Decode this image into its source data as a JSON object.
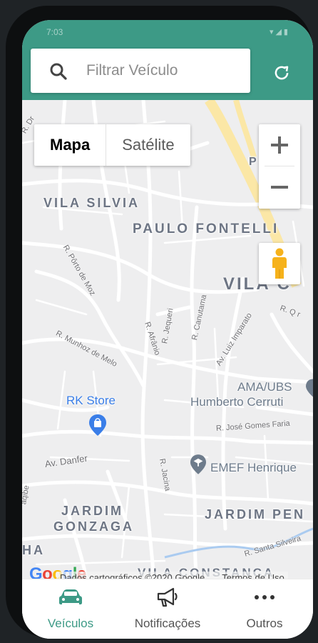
{
  "status_bar": {
    "time": "7:03",
    "icons": "▾◢▮"
  },
  "search": {
    "placeholder": "Filtrar Veículo",
    "value": ""
  },
  "map": {
    "type_buttons": [
      "Mapa",
      "Satélite"
    ],
    "active_type": "Mapa",
    "zoom_in": "+",
    "zoom_out": "−",
    "neighborhoods": {
      "vila_silvia": "VILA SILVIA",
      "paulo_fontelli": "PAULO FONTELLI",
      "vila_c": "VILA C",
      "jardim_gonzaga_1": "JARDIM",
      "jardim_gonzaga_2": "GONZAGA",
      "jardim_pen": "JARDIM PEN",
      "vila_constanca": "VILA CONSTANCA",
      "ha": "HA",
      "pe": "P  E"
    },
    "streets": {
      "porto_de_moz": "R. Pôrto de Moz",
      "munhoz_de_melo": "R. Munhoz de Melo",
      "afranio": "R. Afrânio",
      "jequeri": "R. Jequeri",
      "canutama": "R. Canutama",
      "luiz_imparato": "Av. Luiz Imparato",
      "q_r": "R. Q r",
      "jose_gomes_faria": "R. José Gomes Faria",
      "av_danfer": "Av. Danfer",
      "jacina": "R. Jacina",
      "santa_silveira": "R. Santa Silveira",
      "aqibe": "aqibe",
      "dr": "R. Dr"
    },
    "pois": {
      "rk_store": "RK Store",
      "ama_ubs_1": "AMA/UBS",
      "ama_ubs_2": "Humberto Cerruti",
      "emef": "EMEF Henrique"
    },
    "attribution": "Dados cartográficos ©2020 Google",
    "terms": "Termos de Uso",
    "logo_letters": [
      "G",
      "o",
      "o",
      "g",
      "l",
      "e"
    ]
  },
  "bottom_nav": [
    {
      "label": "Veículos",
      "icon": "car-icon",
      "active": true
    },
    {
      "label": "Notificações",
      "icon": "megaphone-icon",
      "active": false
    },
    {
      "label": "Outros",
      "icon": "more-icon",
      "active": false
    }
  ],
  "colors": {
    "primary": "#3d9a86",
    "map_background": "#eeeeef",
    "road": "#ffffff",
    "major_road": "#fbe7a6",
    "poi_blue": "#3a7ee8",
    "poi_gray": "#6e7c8c",
    "pegman": "#f6b21b"
  }
}
